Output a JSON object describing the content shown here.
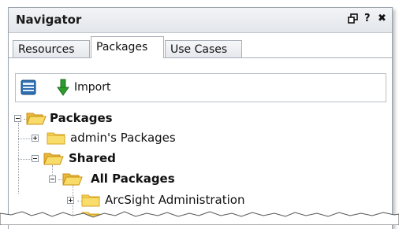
{
  "navigator": {
    "title": "Navigator",
    "controls": {
      "restore_icon": "restore-icon",
      "help": "?",
      "close": "✖"
    }
  },
  "tabs": [
    {
      "label": "Resources",
      "active": false
    },
    {
      "label": "Packages",
      "active": true
    },
    {
      "label": "Use Cases",
      "active": false
    }
  ],
  "toolbar": {
    "view_icon": "list-view-icon",
    "import_icon": "green-down-arrow-icon",
    "import_label": "Import"
  },
  "tree": {
    "root": {
      "label": "Packages",
      "expanded": true
    },
    "admins": {
      "label": "admin's Packages",
      "expanded": false
    },
    "shared": {
      "label": "Shared",
      "expanded": true
    },
    "all": {
      "label": "All Packages",
      "expanded": true
    },
    "arcsight": {
      "label": "ArcSight Administration",
      "expanded": false
    }
  },
  "colors": {
    "folder": "#f5d657",
    "folder_dark": "#d9a521",
    "arrow_green": "#2e9b2e"
  }
}
